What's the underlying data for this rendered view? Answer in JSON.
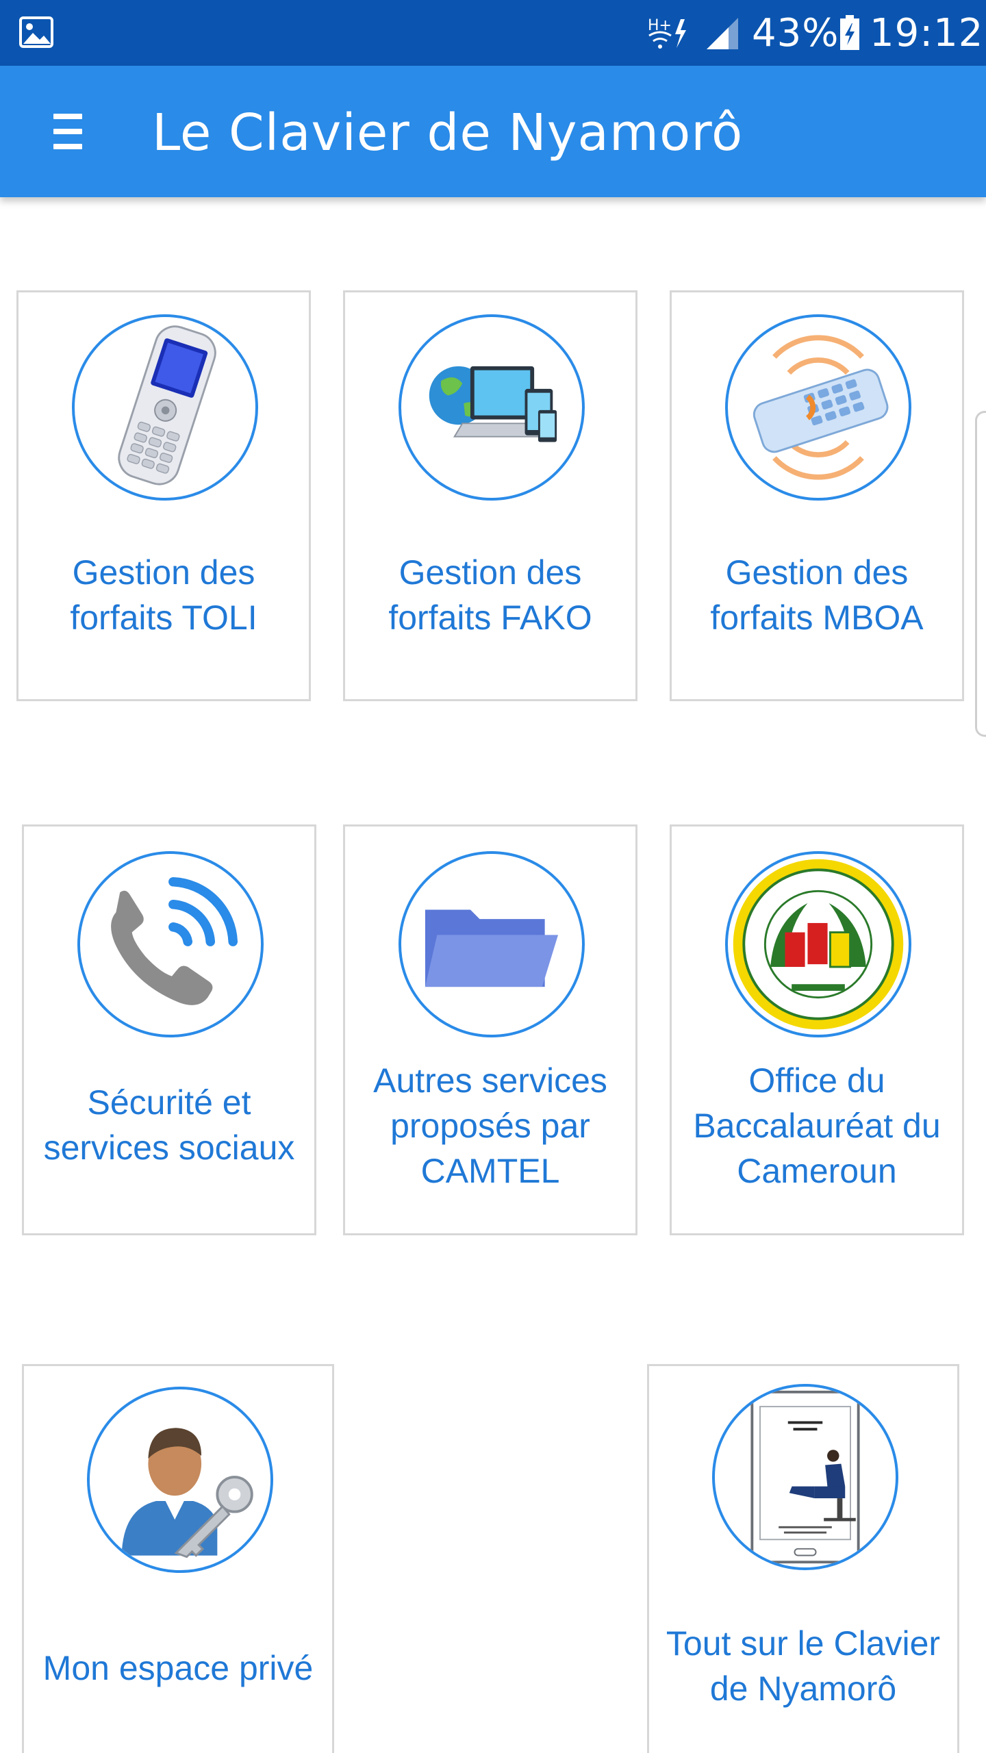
{
  "status_bar": {
    "battery": "43%",
    "time": "19:12",
    "icons": [
      "gallery-icon",
      "network-h-plus-icon",
      "signal-icon",
      "battery-charging-icon"
    ]
  },
  "app_bar": {
    "title": "Le Clavier de Nyamorô",
    "menu_icon": "hamburger-menu-icon"
  },
  "tiles": [
    {
      "label": "Gestion des\nforfaits TOLI",
      "icon": "mobile-phone-icon"
    },
    {
      "label": "Gestion des\nforfaits FAKO",
      "icon": "devices-globe-icon"
    },
    {
      "label": "Gestion des\nforfaits MBOA",
      "icon": "wireless-keypad-icon"
    },
    {
      "label": "Sécurité et\nservices sociaux",
      "icon": "phone-call-icon"
    },
    {
      "label": "Autres services\nproposés par\nCAMTEL",
      "icon": "folder-icon"
    },
    {
      "label": "Office du\nBaccalauréat du\nCameroun",
      "icon": "obc-seal-icon"
    },
    {
      "label": "Mon espace privé",
      "icon": "user-key-icon"
    },
    {
      "label": "Tout sur le Clavier\nde Nyamorô",
      "icon": "app-phone-icon"
    }
  ],
  "colors": {
    "status_bar": "#0b55b0",
    "app_bar": "#2a8be8",
    "accent": "#1f78d6",
    "tile_border": "#d7d7d7"
  }
}
